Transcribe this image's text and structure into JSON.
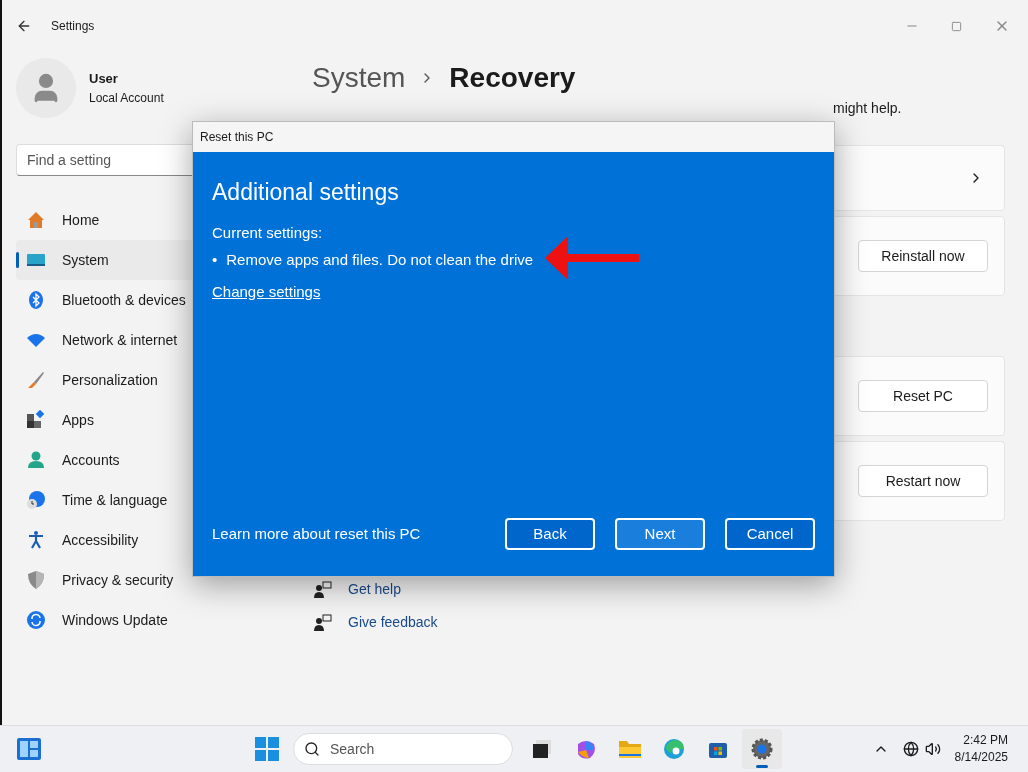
{
  "window": {
    "title": "Settings"
  },
  "user": {
    "name": "User",
    "account": "Local Account"
  },
  "search": {
    "placeholder": "Find a setting"
  },
  "sidebar": {
    "items": [
      {
        "label": "Home",
        "selected": false
      },
      {
        "label": "System",
        "selected": true
      },
      {
        "label": "Bluetooth & devices",
        "selected": false
      },
      {
        "label": "Network & internet",
        "selected": false
      },
      {
        "label": "Personalization",
        "selected": false
      },
      {
        "label": "Apps",
        "selected": false
      },
      {
        "label": "Accounts",
        "selected": false
      },
      {
        "label": "Time & language",
        "selected": false
      },
      {
        "label": "Accessibility",
        "selected": false
      },
      {
        "label": "Privacy & security",
        "selected": false
      },
      {
        "label": "Windows Update",
        "selected": false
      }
    ]
  },
  "breadcrumb": {
    "parent": "System",
    "current": "Recovery"
  },
  "description_fragment": "might help.",
  "cards": [
    {
      "kind": "chevron"
    },
    {
      "kind": "button",
      "button": "Reinstall now"
    },
    {
      "kind": "button",
      "button": "Reset PC"
    },
    {
      "kind": "button",
      "button": "Restart now"
    }
  ],
  "help_links": [
    "Get help",
    "Give feedback"
  ],
  "dialog": {
    "title": "Reset this PC",
    "heading": "Additional settings",
    "current_label": "Current settings:",
    "bullet_mark": "•",
    "bullets": [
      "Remove apps and files. Do not clean the drive"
    ],
    "change_link": "Change settings",
    "learn_more": "Learn more about reset this PC",
    "buttons": [
      {
        "label": "Back",
        "selected": false
      },
      {
        "label": "Next",
        "selected": true
      },
      {
        "label": "Cancel",
        "selected": false
      }
    ]
  },
  "taskbar": {
    "search_placeholder": "Search",
    "apps": [
      {
        "selected": false
      },
      {
        "selected": false
      },
      {
        "selected": false
      },
      {
        "selected": false
      },
      {
        "selected": false
      },
      {
        "selected": true
      }
    ],
    "time": "2:42 PM",
    "date": "8/14/2025"
  }
}
